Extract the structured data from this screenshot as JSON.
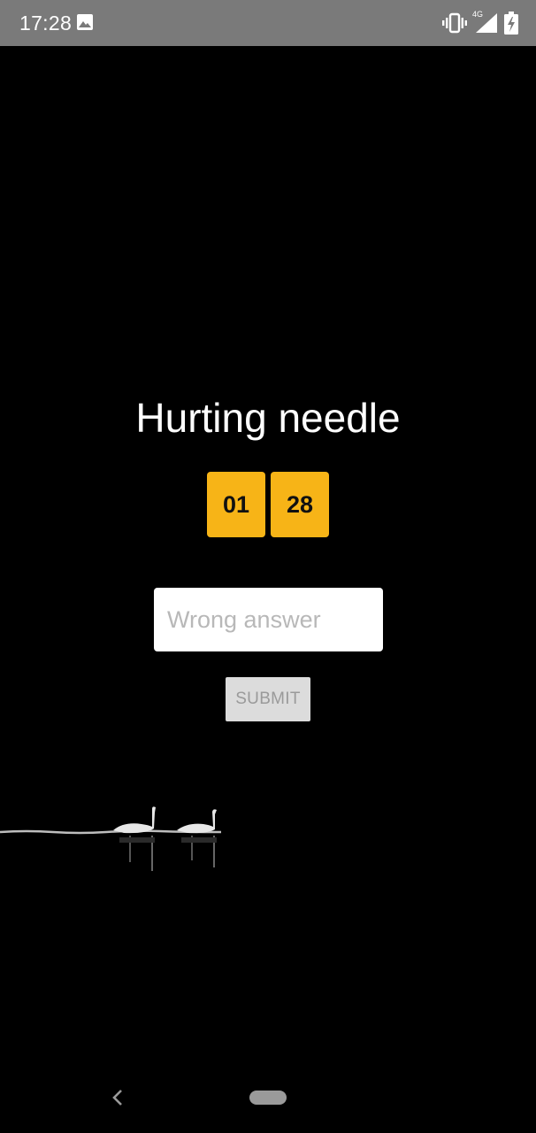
{
  "status_bar": {
    "time": "17:28",
    "network_label": "4G",
    "icons": [
      "image-icon",
      "vibrate-icon",
      "signal-icon",
      "battery-icon"
    ]
  },
  "puzzle": {
    "title": "Hurting needle",
    "timer": {
      "minutes": "01",
      "seconds": "28"
    },
    "answer_input": {
      "value": "",
      "placeholder": "Wrong answer"
    },
    "submit_label": "SUBMIT"
  },
  "colors": {
    "background": "#000000",
    "timer_box": "#f7b417",
    "status_bar": "#7a7a7a",
    "submit_bg": "#dcdcdc"
  },
  "nav_bar": {
    "icons": [
      "back-icon",
      "home-pill-icon"
    ]
  }
}
